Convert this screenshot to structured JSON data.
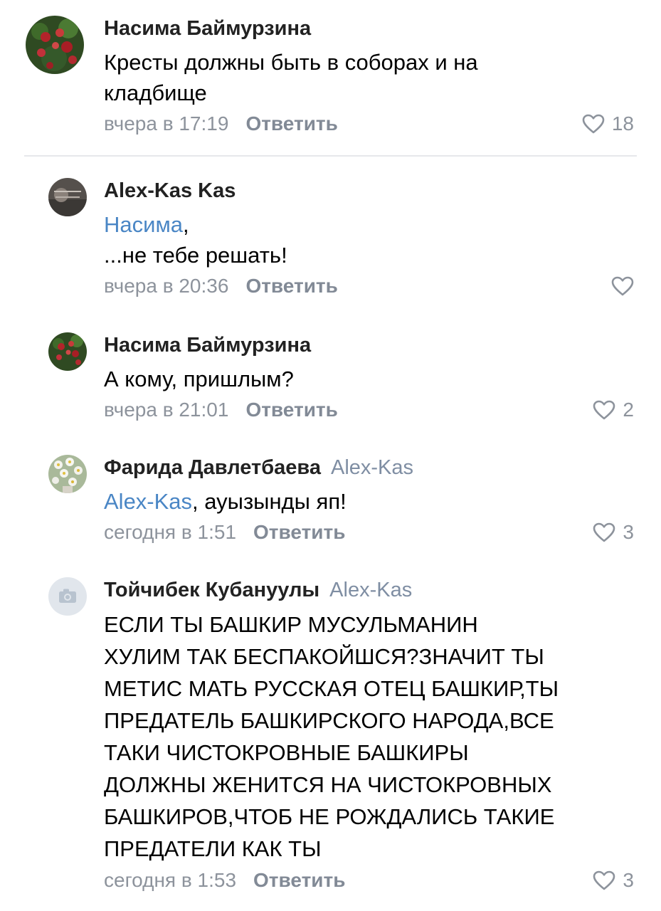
{
  "comments": [
    {
      "author": "Насима Баймурзина",
      "reply_to": "",
      "mention": "",
      "text_lines": [
        "Кресты должны быть в соборах и на",
        "кладбище"
      ],
      "time": "вчера в 17:19",
      "reply_label": "Ответить",
      "likes": "18",
      "avatar_icon": "red-flowers-avatar"
    },
    {
      "author": "Alex-Kas Kas",
      "reply_to": "",
      "mention": "Насима",
      "text_lines": [
        "...не тебе решать!"
      ],
      "time": "вчера в 20:36",
      "reply_label": "Ответить",
      "likes": "",
      "avatar_icon": "dark-photo-avatar"
    },
    {
      "author": "Насима Баймурзина",
      "reply_to": "",
      "mention": "",
      "text_lines": [
        "А кому, пришлым?"
      ],
      "time": "вчера в 21:01",
      "reply_label": "Ответить",
      "likes": "2",
      "avatar_icon": "red-flowers-avatar"
    },
    {
      "author": "Фарида Давлетбаева",
      "reply_to": "Alex-Kas",
      "mention": "Alex-Kas",
      "mention_suffix": ", ауызынды яп!",
      "text_lines": [],
      "time": "сегодня в 1:51",
      "reply_label": "Ответить",
      "likes": "3",
      "avatar_icon": "daisies-avatar"
    },
    {
      "author": "Тойчибек Кубануулы",
      "reply_to": "Alex-Kas",
      "mention": "",
      "text_lines": [
        "ЕСЛИ ТЫ БАШКИР МУСУЛЬМАНИН",
        "ХУЛИМ ТАК БЕСПАКОЙШСЯ?ЗНАЧИТ ТЫ",
        "МЕТИС МАТЬ РУССКАЯ ОТЕЦ БАШКИР,ТЫ",
        "ПРЕДАТЕЛЬ БАШКИРСКОГО НАРОДА,ВСЕ",
        "ТАКИ ЧИСТОКРОВНЫЕ БАШКИРЫ",
        "ДОЛЖНЫ ЖЕНИТСЯ НА ЧИСТОКРОВНЫХ",
        "БАШКИРОВ,ЧТОБ НЕ РОЖДАЛИСЬ ТАКИЕ",
        "ПРЕДАТЕЛИ КАК ТЫ"
      ],
      "time": "сегодня в 1:53",
      "reply_label": "Ответить",
      "likes": "3",
      "avatar_icon": "camera-placeholder-avatar"
    }
  ],
  "colors": {
    "mention": "#4a86c5",
    "meta": "#8d939c",
    "divider": "#e6e8eb"
  }
}
